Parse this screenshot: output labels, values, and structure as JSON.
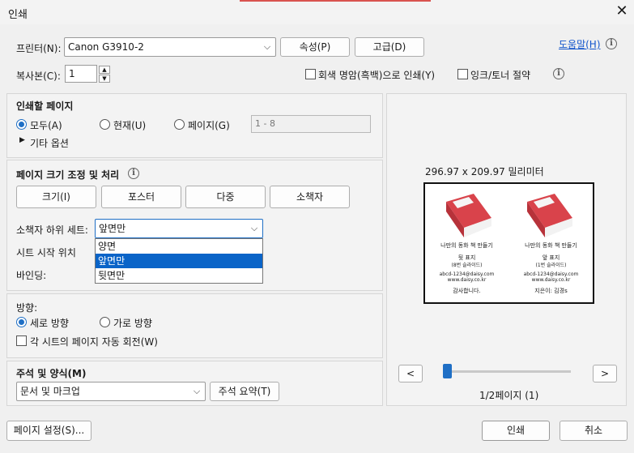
{
  "window": {
    "title": "인쇄",
    "close_glyph": "✕"
  },
  "printer": {
    "label": "프린터(N):",
    "selected": "Canon G3910-2",
    "properties_button": "속성(P)",
    "advanced_button": "고급(D)",
    "help_link": "도움말(H)"
  },
  "copies": {
    "label": "복사본(C):",
    "value": "1",
    "grayscale_label": "회색 명암(흑백)으로 인쇄(Y)",
    "save_ink_label": "잉크/토너 절약"
  },
  "pages_to_print": {
    "heading": "인쇄할 페이지",
    "all_label": "모두(A)",
    "current_label": "현재(U)",
    "pages_label": "페이지(G)",
    "pages_placeholder": "1 - 8",
    "more_options": "기타 옵션",
    "selected": "all"
  },
  "page_sizing": {
    "heading": "페이지 크기 조정 및 처리",
    "size_button": "크기(I)",
    "poster_button": "포스터",
    "multiple_button": "다중",
    "booklet_button": "소책자",
    "subset_label": "소책자 하위 세트:",
    "subset_selected": "앞면만",
    "sheet_start_label": "시트 시작 위치",
    "binding_label": "바인딩:",
    "subset_options": [
      "양면",
      "앞면만",
      "뒷면만"
    ],
    "subset_highlighted_index": 1
  },
  "orientation": {
    "heading": "방향:",
    "portrait_label": "세로 방향",
    "landscape_label": "가로 방향",
    "auto_rotate_label": "각 시트의 페이지 자동 회전(W)",
    "selected": "portrait"
  },
  "comments": {
    "heading": "주석 및 양식(M)",
    "selected": "문서 및 마크업",
    "summary_button": "주석 요약(T)"
  },
  "preview": {
    "dimensions": "296.97 x 209.97 밀리미터",
    "page_indicator": "1/2페이지 (1)",
    "prev_button": "<",
    "next_button": ">",
    "slider_value": 0,
    "page_left": {
      "title": "나만의 동화 책 만들기",
      "sub1": "뒷 표지",
      "sub2": "(8번 슬라이드)",
      "sub3": "abcd-1234@daisy.com",
      "sub4": "www.daisy.co.kr",
      "closing": "감사합니다."
    },
    "page_right": {
      "title": "나만의 동화 책 만들기",
      "sub1": "앞 표지",
      "sub2": "(1번 슬라이드)",
      "sub3": "abcd-1234@daisy.com",
      "sub4": "www.daisy.co.kr",
      "closing": "지은이: 김경s"
    }
  },
  "footer": {
    "page_setup_button": "페이지 설정(S)...",
    "print_button": "인쇄",
    "cancel_button": "취소"
  },
  "colors": {
    "accent": "#1f6fc5",
    "book_red": "#d9434b"
  }
}
